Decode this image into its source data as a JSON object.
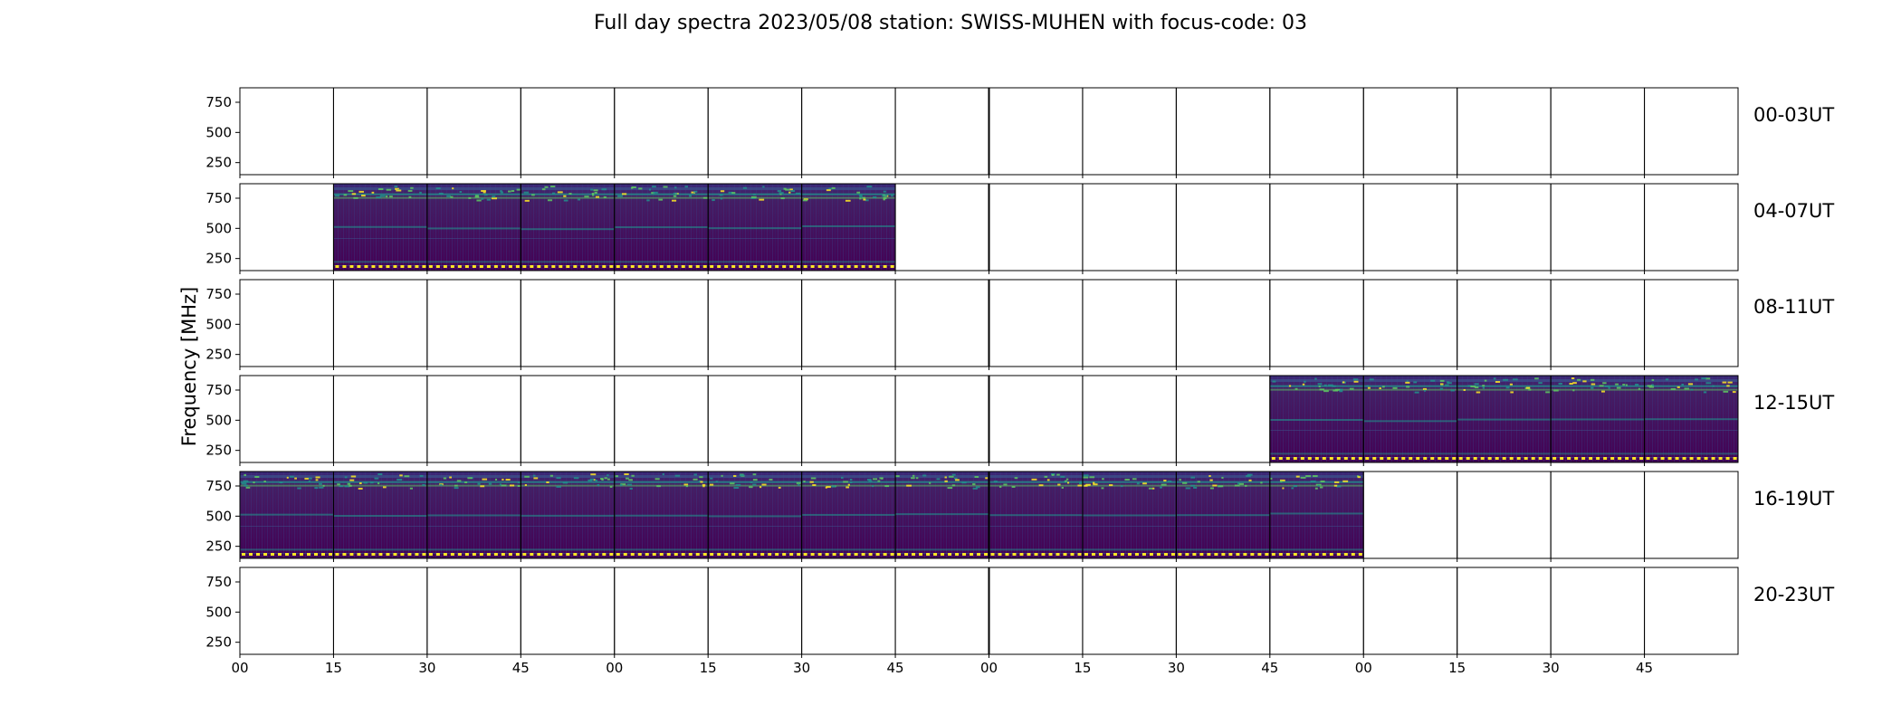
{
  "chart_data": {
    "type": "heatmap",
    "title": "Full day spectra 2023/05/08 station: SWISS-MUHEN with focus-code: 03",
    "ylabel": "Frequency [MHz]",
    "xlabel": "",
    "y_ticks": [
      "750",
      "500",
      "250"
    ],
    "y_tick_values": [
      750,
      500,
      250
    ],
    "ylim": [
      150,
      870
    ],
    "x_ticks": [
      "00",
      "15",
      "30",
      "45",
      "00",
      "15",
      "30",
      "45",
      "00",
      "15",
      "30",
      "45",
      "00",
      "15",
      "30",
      "45"
    ],
    "columns_per_row": 16,
    "minutes_per_column": 15,
    "colormap": [
      "#440154",
      "#3b528b",
      "#21918c",
      "#5ec962",
      "#fde725"
    ],
    "rows": [
      {
        "label": "00-03UT",
        "filled": []
      },
      {
        "label": "04-07UT",
        "filled": [
          1,
          2,
          3,
          4,
          5,
          6
        ]
      },
      {
        "label": "08-11UT",
        "filled": []
      },
      {
        "label": "12-15UT",
        "filled": [
          11,
          12,
          13,
          14,
          15
        ]
      },
      {
        "label": "16-19UT",
        "filled": [
          0,
          1,
          2,
          3,
          4,
          5,
          6,
          7,
          8,
          9,
          10,
          11
        ]
      },
      {
        "label": "20-23UT",
        "filled": []
      }
    ]
  }
}
